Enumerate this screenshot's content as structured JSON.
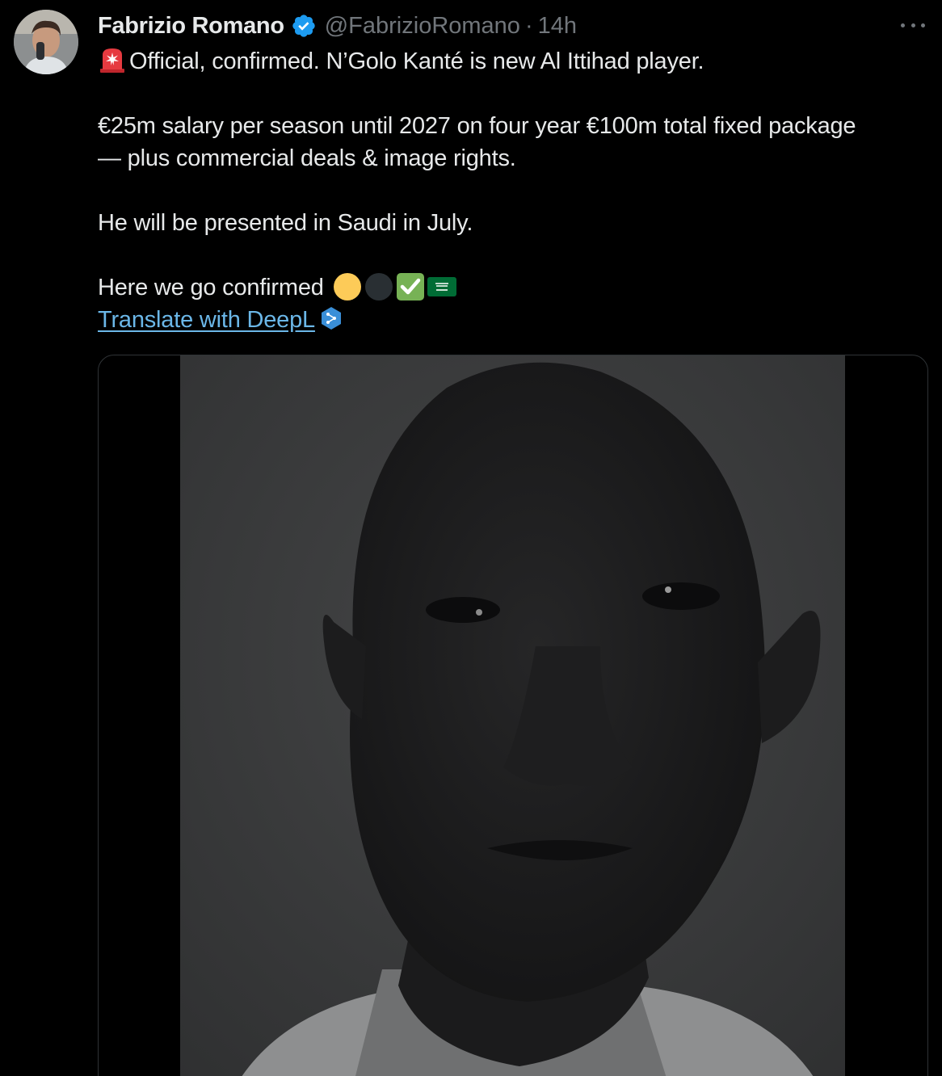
{
  "tweet": {
    "author_name": "Fabrizio Romano",
    "handle": "@FabrizioRomano",
    "separator": "·",
    "time": "14h",
    "more_icon": "ellipsis-icon",
    "verified_icon": "verified-badge-icon",
    "lines": {
      "line1": "Official, confirmed. N’Golo Kanté is new Al Ittihad player.",
      "line2": "€25m salary per season until 2027 on four year €100m total fixed package",
      "line3": "— plus commercial deals & image rights.",
      "line4": "He will be presented in Saudi in July.",
      "line5": "Here we go confirmed"
    },
    "emojis": [
      "siren-emoji",
      "yellow-circle-emoji",
      "black-circle-emoji",
      "check-mark-emoji",
      "saudi-flag-emoji"
    ],
    "translate_link": "Translate with DeepL",
    "translate_icon": "deepl-icon"
  },
  "colors": {
    "background": "#000000",
    "text": "#e7e9ea",
    "muted": "#71767b",
    "link": "#6bb7e8",
    "verified": "#1d9bf0",
    "media_border": "#2f3336"
  }
}
